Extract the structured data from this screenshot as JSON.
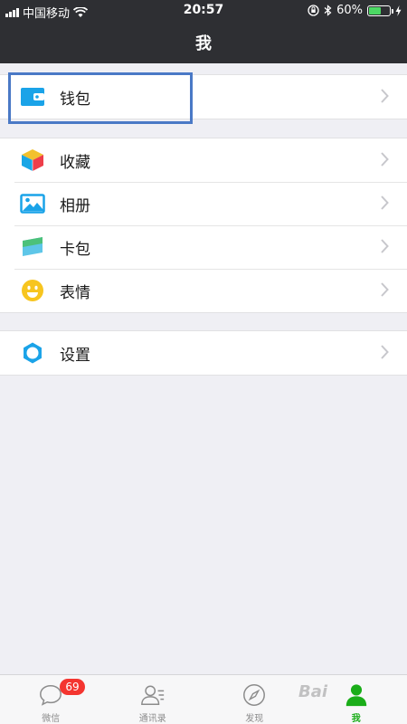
{
  "status": {
    "carrier": "中国移动",
    "time": "20:57",
    "battery": "60%",
    "battery_level": 0.6
  },
  "nav": {
    "title": "我"
  },
  "groups": [
    {
      "items": [
        {
          "label": "钱包",
          "icon": "wallet-icon"
        }
      ]
    },
    {
      "items": [
        {
          "label": "收藏",
          "icon": "cube-icon"
        },
        {
          "label": "相册",
          "icon": "photo-icon"
        },
        {
          "label": "卡包",
          "icon": "card-icon"
        },
        {
          "label": "表情",
          "icon": "smiley-icon"
        }
      ]
    },
    {
      "items": [
        {
          "label": "设置",
          "icon": "gear-icon"
        }
      ]
    }
  ],
  "tabbar": {
    "tabs": [
      {
        "label": "微信",
        "badge": "69"
      },
      {
        "label": "通讯录"
      },
      {
        "label": "发现"
      },
      {
        "label": "我",
        "active": true
      }
    ]
  },
  "watermark": "Bai",
  "colors": {
    "accent": "#1aad19",
    "highlight": "#4a79c6",
    "badge": "#f43530",
    "header": "#2e2f33"
  }
}
